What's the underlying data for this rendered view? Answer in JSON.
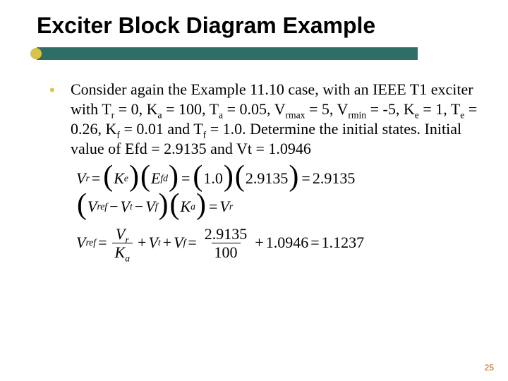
{
  "title": "Exciter Block Diagram Example",
  "bullet": {
    "text_parts": {
      "p1": "Consider again the Example 11.10 case, with an IEEE T1 exciter with T",
      "s1": "r",
      "p2": " = 0, K",
      "s2": "a",
      "p3": " = 100, T",
      "s3": "a",
      "p4": " = 0.05, V",
      "s4": "rmax",
      "p5": " = 5, V",
      "s5": "rmin",
      "p6": " = -5, K",
      "s6": "e",
      "p7": " = 1, T",
      "s7": "e",
      "p8": " = 0.26, K",
      "s8": "f",
      "p9": " = 0.01 and T",
      "s9": "f",
      "p10": " = 1.0. Determine the initial states.  Initial value of Efd = 2.9135 and Vt = 1.0946"
    }
  },
  "eq1": {
    "Vr": "V",
    "Vr_sub": "r",
    "Ke": "K",
    "Ke_sub": "e",
    "Efd": "E",
    "Efd_sub": "fd",
    "val1": "1.0",
    "val2": "2.9135",
    "result": "2.9135"
  },
  "eq2": {
    "Vref": "V",
    "Vref_sub": "ref",
    "Vt": "V",
    "Vt_sub": "t",
    "Vf": "V",
    "Vf_sub": "f",
    "Ka": "K",
    "Ka_sub": "a",
    "Vr": "V",
    "Vr_sub": "r"
  },
  "eq3": {
    "Vref": "V",
    "Vref_sub": "ref",
    "Vr": "V",
    "Vr_sub": "r",
    "Ka": "K",
    "Ka_sub": "a",
    "Vt": "V",
    "Vt_sub": "t",
    "Vf": "V",
    "Vf_sub": "f",
    "num_top": "2.9135",
    "num_bot": "100",
    "plus_val": "1.0946",
    "result": "1.1237"
  },
  "page_number": "25"
}
